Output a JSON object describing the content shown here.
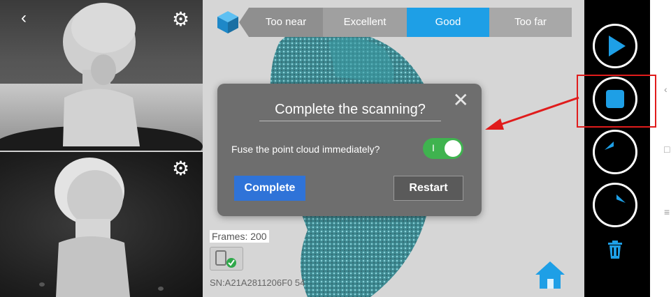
{
  "distance_bar": {
    "segments": [
      {
        "label": "Too near",
        "color": "#8f8f8f"
      },
      {
        "label": "Excellent",
        "color": "#a0a0a0"
      },
      {
        "label": "Good",
        "color": "#1e9fe6"
      },
      {
        "label": "Too far",
        "color": "#a8a8a8"
      }
    ],
    "active": "Good"
  },
  "dialog": {
    "title": "Complete the scanning?",
    "fuse_label": "Fuse the point cloud immediately?",
    "toggle_on_mark": "I",
    "toggle_state": "on",
    "complete_label": "Complete",
    "restart_label": "Restart"
  },
  "stats": {
    "frames": "Frames: 200",
    "serial": "SN:A21A2811206F0 54"
  },
  "camera": {
    "back_glyph": "‹"
  },
  "controls": {
    "accent": "#1e9fe6",
    "items": [
      "play-icon",
      "stop-icon",
      "undo-icon",
      "redo-icon",
      "trash-icon"
    ]
  },
  "colors": {
    "highlight": "#e01c1c",
    "accent": "#1e9fe6",
    "toggle": "#3fb34f",
    "primary_button": "#2f73d8"
  },
  "edge": {
    "glyph_1": "‹",
    "glyph_2": "□",
    "glyph_3": "≡"
  }
}
